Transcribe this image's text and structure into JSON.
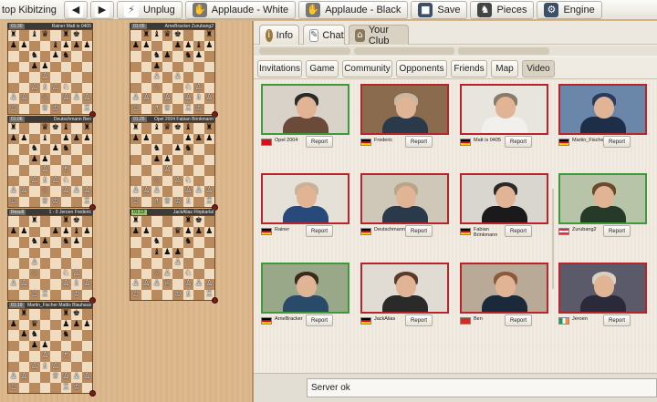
{
  "toolbar": {
    "stop_label": "top Kibitzing",
    "unplug_label": "Unplug",
    "applaud_white_label": "Applaude - White",
    "applaud_black_label": "Applaude - Black",
    "save_label": "Save",
    "pieces_label": "Pieces",
    "engine_label": "Engine"
  },
  "boards": [
    {
      "time_left": "01:30",
      "names": "Rainer Matt is 0405",
      "time_right": "",
      "highlight": false
    },
    {
      "time_left": "01:05",
      "names": "ArneBracker Zurubang2",
      "time_right": "",
      "highlight": false
    },
    {
      "time_left": "01:06",
      "names": "Deutschmann Ben",
      "time_right": "",
      "highlight": false
    },
    {
      "time_left": "01:25",
      "names": "Opel 2004 Fabian Brinkmann",
      "time_right": "",
      "highlight": false
    },
    {
      "time_left": "Result",
      "names": "1 - 0    Jeroen Frederic",
      "time_right": "",
      "highlight": false
    },
    {
      "time_left": "01:13",
      "names": "JackAlias Flirpkarlal",
      "time_right": "",
      "highlight": true
    },
    {
      "time_left": "01:19",
      "names": "Martin_Fischer Mattis Blauhaus",
      "time_right": "",
      "highlight": false
    }
  ],
  "main_tabs": [
    {
      "label": "Info",
      "icon": "info-icon"
    },
    {
      "label": "Chat",
      "icon": "chat-icon"
    },
    {
      "label": "Your Club",
      "icon": "club-icon"
    }
  ],
  "sub_tabs": [
    "Invitations",
    "Game",
    "Community",
    "Opponents",
    "Friends",
    "Map",
    "Video"
  ],
  "active_sub_tab": "Video",
  "video_users": [
    {
      "name": "Opel 2004",
      "flag": "tr",
      "border": "green"
    },
    {
      "name": "Frederic",
      "flag": "de",
      "border": "red"
    },
    {
      "name": "Matt is 0405",
      "flag": "de",
      "border": "red"
    },
    {
      "name": "Martin_Fischer",
      "flag": "de",
      "border": "red"
    },
    {
      "name": "Rainer",
      "flag": "de",
      "border": "red"
    },
    {
      "name": "Deutschmann",
      "flag": "de",
      "border": "red"
    },
    {
      "name": "Fabian Brinkmann",
      "flag": "de",
      "border": "red"
    },
    {
      "name": "Zurubang2",
      "flag": "at",
      "border": "green"
    },
    {
      "name": "ArneBracker",
      "flag": "de",
      "border": "green"
    },
    {
      "name": "JackAlias",
      "flag": "de",
      "border": "red"
    },
    {
      "name": "Ben",
      "flag": "ch",
      "border": "red"
    },
    {
      "name": "Jeroen",
      "flag": "ie",
      "border": "red"
    }
  ],
  "report_label": "Report",
  "status": "Server ok",
  "colors": {
    "active_border": "#3c9a3a",
    "inactive_border": "#b8242a",
    "board_light": "#f0dcc0",
    "board_dark": "#b98a5e"
  }
}
